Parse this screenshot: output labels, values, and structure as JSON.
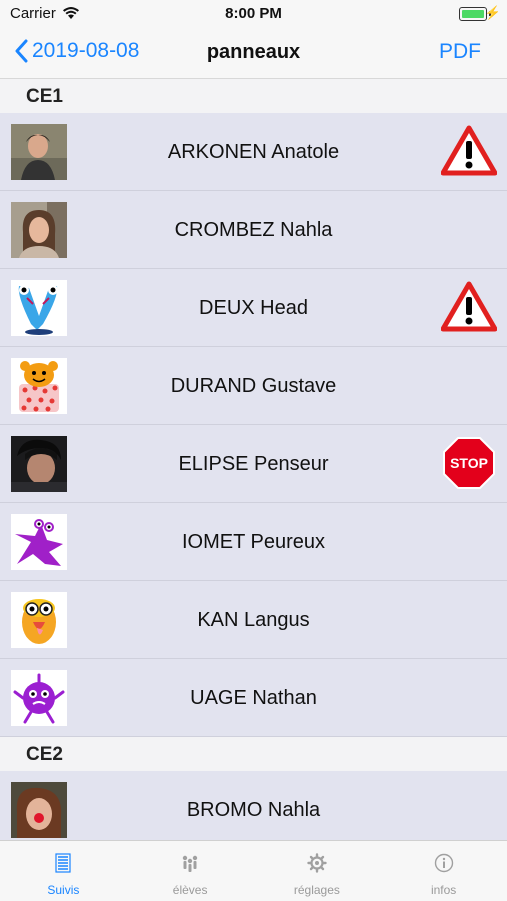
{
  "status": {
    "carrier": "Carrier",
    "time": "8:00 PM"
  },
  "nav": {
    "back_label": "2019-08-08",
    "title": "panneaux",
    "pdf_label": "PDF"
  },
  "colors": {
    "accent": "#1a85ff",
    "row_bg": "#e2e3ef",
    "warning_red": "#e1201f",
    "stop_red": "#e3001b"
  },
  "sections": [
    {
      "title": "CE1",
      "students": [
        {
          "name": "ARKONEN Anatole",
          "avatar": "photo-boy",
          "badge": "warning-sign-icon"
        },
        {
          "name": "CROMBEZ Nahla",
          "avatar": "photo-girl",
          "badge": ""
        },
        {
          "name": "DEUX Head",
          "avatar": "blue-twin-monster",
          "badge": "warning-sign-icon"
        },
        {
          "name": "DURAND Gustave",
          "avatar": "orange-dotted-monster",
          "badge": ""
        },
        {
          "name": "ELIPSE Penseur",
          "avatar": "photo-dark",
          "badge": "stop-sign-icon"
        },
        {
          "name": "IOMET Peureux",
          "avatar": "purple-splat-monster",
          "badge": ""
        },
        {
          "name": "KAN Langus",
          "avatar": "yellow-owl-monster",
          "badge": ""
        },
        {
          "name": "UAGE Nathan",
          "avatar": "purple-fuzzy-monster",
          "badge": ""
        }
      ]
    },
    {
      "title": "CE2",
      "students": [
        {
          "name": "BROMO Nahla",
          "avatar": "photo-clown",
          "badge": ""
        }
      ]
    }
  ],
  "stop_text": "STOP",
  "tabs": [
    {
      "label": "Suivis",
      "icon": "list-icon",
      "active": true
    },
    {
      "label": "élèves",
      "icon": "people-icon",
      "active": false
    },
    {
      "label": "réglages",
      "icon": "gear-icon",
      "active": false
    },
    {
      "label": "infos",
      "icon": "info-icon",
      "active": false
    }
  ]
}
